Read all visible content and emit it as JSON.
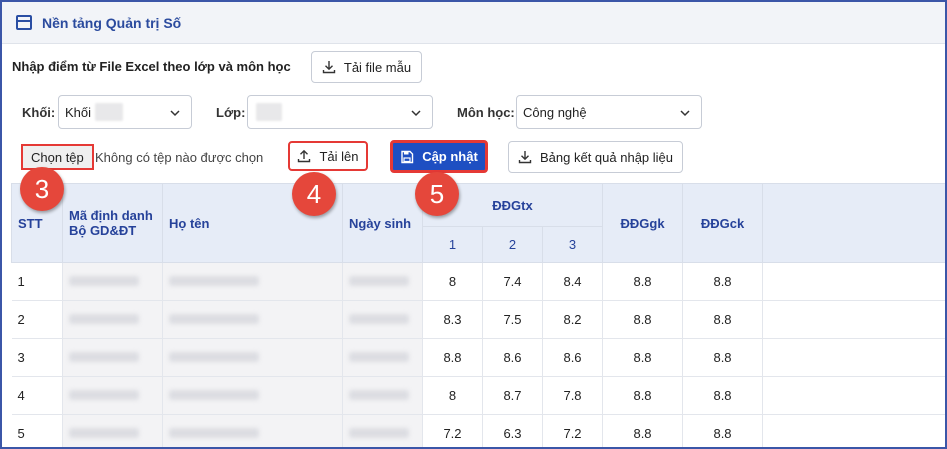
{
  "window": {
    "title": "Nền tảng Quản trị Số"
  },
  "import": {
    "heading": "Nhập điểm từ File Excel theo lớp và môn học",
    "download_template_label": "Tải file mẫu"
  },
  "filters": {
    "grade_label": "Khối:",
    "grade_value": "Khối",
    "class_label": "Lớp:",
    "class_value": "",
    "subject_label": "Môn học:",
    "subject_value": "Công nghệ"
  },
  "file": {
    "choose_label": "Chọn tệp",
    "no_file_text": "Không có tệp nào được chọn",
    "upload_label": "Tải lên",
    "update_label": "Cập nhật",
    "result_label": "Bảng kết quả nhập liệu"
  },
  "steps": [
    "3",
    "4",
    "5"
  ],
  "table": {
    "headers": {
      "stt": "STT",
      "id": "Mã định danh Bộ GD&ĐT",
      "name": "Họ tên",
      "dob": "Ngày sinh",
      "ddgtx": "ĐĐGtx",
      "ddgtx_sub": [
        "1",
        "2",
        "3"
      ],
      "ddggk": "ĐĐGgk",
      "ddgck": "ĐĐGck"
    },
    "rows": [
      {
        "stt": "1",
        "tx": [
          "8",
          "7.4",
          "8.4"
        ],
        "gk": "8.8",
        "ck": "8.8"
      },
      {
        "stt": "2",
        "tx": [
          "8.3",
          "7.5",
          "8.2"
        ],
        "gk": "8.8",
        "ck": "8.8"
      },
      {
        "stt": "3",
        "tx": [
          "8.8",
          "8.6",
          "8.6"
        ],
        "gk": "8.8",
        "ck": "8.8"
      },
      {
        "stt": "4",
        "tx": [
          "8",
          "8.7",
          "7.8"
        ],
        "gk": "8.8",
        "ck": "8.8"
      },
      {
        "stt": "5",
        "tx": [
          "7.2",
          "6.3",
          "7.2"
        ],
        "gk": "8.8",
        "ck": "8.8"
      }
    ]
  },
  "colors": {
    "accent": "#1e4fc2",
    "highlight": "#e53935",
    "header_text": "#26429a"
  }
}
